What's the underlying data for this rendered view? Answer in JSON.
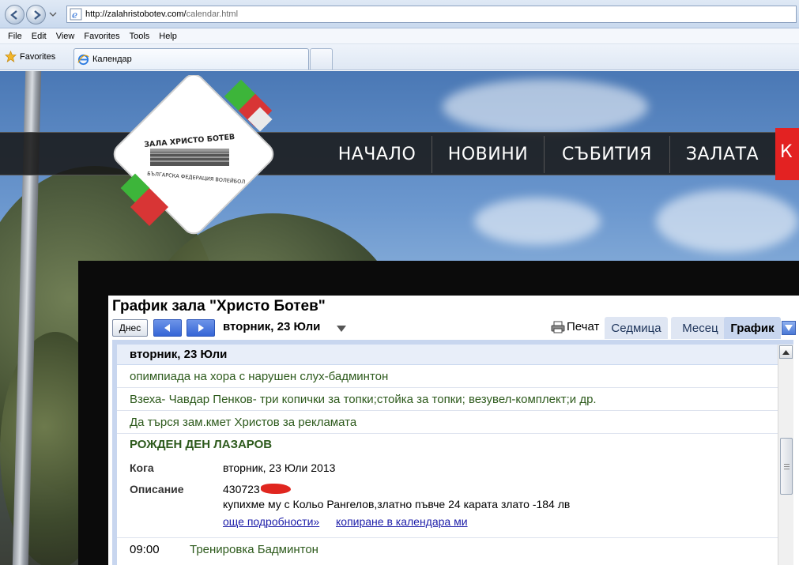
{
  "browser": {
    "url_host": "http://zalahristobotev.com/",
    "url_path": "calendar.html",
    "menu": [
      "File",
      "Edit",
      "View",
      "Favorites",
      "Tools",
      "Help"
    ],
    "favorites_label": "Favorites",
    "tab_title": "Календар"
  },
  "site": {
    "nav": [
      "НАЧАЛО",
      "НОВИНИ",
      "СЪБИТИЯ",
      "ЗАЛАТА",
      "К"
    ],
    "logo_top_text": "ЗАЛА ХРИСТО БОТЕВ",
    "logo_bottom_text": "БЪЛГАРСКА ФЕДЕРАЦИЯ ВОЛЕЙБОЛ"
  },
  "calendar": {
    "title": "График зала \"Христо Ботев\"",
    "today_label": "Днес",
    "current_date": "вторник, 23 Юли",
    "print_label": "Печат",
    "view_tabs": [
      "Седмица",
      "Месец",
      "График"
    ],
    "active_view": "График",
    "day_header": "вторник, 23 Юли",
    "events": [
      "опимпиада на хора с нарушен слух-бадминтон",
      "Взеха- Чавдар Пенков- три копички за топки;стойка за топки; везувел-комплект;и др.",
      "Да търся зам.кмет Христов за рекламата"
    ],
    "detail": {
      "title": "РОЖДЕН ДЕН ЛАЗАРОВ",
      "when_label": "Кога",
      "when_value": "вторник, 23 Юли 2013",
      "description_label": "Описание",
      "description_line1": "430723",
      "description_line2": "купихме му с Кольо Рангелов,златно пъвче 24 карата злато -184 лв",
      "link_more": "още подробности»",
      "link_copy": "копиране в календара ми"
    },
    "timed_event": {
      "time": "09:00",
      "title": "Тренировка Бадминтон"
    }
  },
  "colors": {
    "event_text": "#2d5a1c",
    "nav_red": "#e32222",
    "tab_active": "#c8d6ef",
    "link": "#1c1ca8"
  }
}
